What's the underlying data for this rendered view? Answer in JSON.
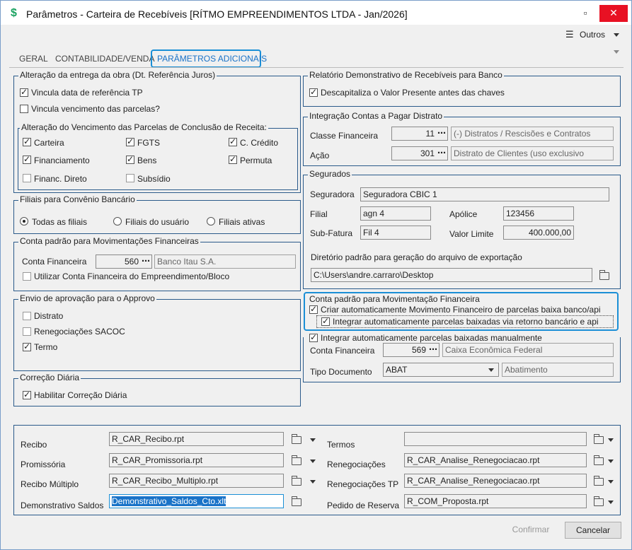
{
  "window": {
    "title": "Parâmetros - Carteira de Recebíveis [RÍTMO EMPREENDIMENTOS LTDA - Jan/2026]",
    "minimize": "▫",
    "close": "✕"
  },
  "toolbar": {
    "outros_label": "Outros"
  },
  "tabs": [
    {
      "label": "GERAL"
    },
    {
      "label": "CONTABILIDADE/VENDA"
    },
    {
      "label": "PARÂMETROS ADICIONAIS"
    }
  ],
  "alteracao_entrega": {
    "title": "Alteração da entrega da obra (Dt. Referência Juros)",
    "vincula_tp": "Vincula data de referência TP",
    "vincula_venc": "Vincula vencimento das parcelas?"
  },
  "alteracao_venc": {
    "title": "Alteração do Vencimento das Parcelas de Conclusão de Receita:",
    "items": [
      "Carteira",
      "FGTS",
      "C. Crédito",
      "Financiamento",
      "Bens",
      "Permuta",
      "Financ. Direto",
      "Subsídio"
    ]
  },
  "filiais": {
    "title": "Filiais para Convênio Bancário",
    "options": [
      "Todas as filiais",
      "Filiais do usuário",
      "Filiais ativas"
    ]
  },
  "conta_padrao": {
    "title": "Conta padrão para Movimentações Financeiras",
    "label": "Conta Financeira",
    "code": "560",
    "name": "Banco Itau S.A.",
    "utilizar": "Utilizar Conta Financeira do Empreendimento/Bloco"
  },
  "approvo": {
    "title": "Envio de aprovação para o Approvo",
    "items": [
      "Distrato",
      "Renegociações SACOC",
      "Termo"
    ]
  },
  "correcao": {
    "title": "Correção Diária",
    "habilitar": "Habilitar Correção Diária"
  },
  "relatorio": {
    "title": "Relatório Demonstrativo de Recebíveis para Banco",
    "descapitaliza": "Descapitaliza o Valor Presente antes das chaves"
  },
  "integracao": {
    "title": "Integração Contas a Pagar Distrato",
    "classe_label": "Classe Financeira",
    "classe_code": "11",
    "classe_name": "(-) Distratos / Rescisões e Contratos",
    "acao_label": "Ação",
    "acao_code": "301",
    "acao_name": "Distrato de Clientes (uso exclusivo"
  },
  "segurados": {
    "title": "Segurados",
    "seguradora_label": "Seguradora",
    "seguradora": "Seguradora CBIC 1",
    "filial_label": "Filial",
    "filial": "agn 4",
    "apolice_label": "Apólice",
    "apolice": "123456",
    "subfatura_label": "Sub-Fatura",
    "subfatura": "Fil  4",
    "valor_limite_label": "Valor Limite",
    "valor_limite": "400.000,00",
    "diretorio_label": "Diretório padrão para geração do arquivo de exportação",
    "diretorio": "C:\\Users\\andre.carraro\\Desktop"
  },
  "mov_fin": {
    "title": "Conta padrão para Movimentação Financeira",
    "criar": "Criar automaticamente Movimento Financeiro de parcelas baixa banco/api",
    "integrar_retorno": "Integrar automaticamente parcelas baixadas via retorno bancário e api",
    "integrar_manual": "Integrar automaticamente parcelas baixadas manualmente",
    "conta_label": "Conta Financeira",
    "conta_code": "569",
    "conta_name": "Caixa Econômica Federal",
    "tipo_label": "Tipo Documento",
    "tipo_value": "ABAT",
    "tipo_name": "Abatimento"
  },
  "reports": {
    "left": [
      {
        "label": "Recibo",
        "value": "R_CAR_Recibo.rpt"
      },
      {
        "label": "Promissória",
        "value": "R_CAR_Promissoria.rpt"
      },
      {
        "label": "Recibo Múltiplo",
        "value": "R_CAR_Recibo_Multiplo.rpt"
      },
      {
        "label": "Demonstrativo Saldos",
        "value": "Demonstrativo_Saldos_Cto.xlt"
      }
    ],
    "right": [
      {
        "label": "Termos",
        "value": ""
      },
      {
        "label": "Renegociações",
        "value": "R_CAR_Analise_Renegociacao.rpt"
      },
      {
        "label": "Renegociações TP",
        "value": "R_CAR_Analise_Renegociacao.rpt"
      },
      {
        "label": "Pedido de Reserva",
        "value": "R_COM_Proposta.rpt"
      }
    ]
  },
  "footer": {
    "confirmar": "Confirmar",
    "cancelar": "Cancelar"
  },
  "colors": {
    "accent": "#1b8fd6",
    "group_border": "#2a5a8a",
    "close_red": "#e81123"
  }
}
